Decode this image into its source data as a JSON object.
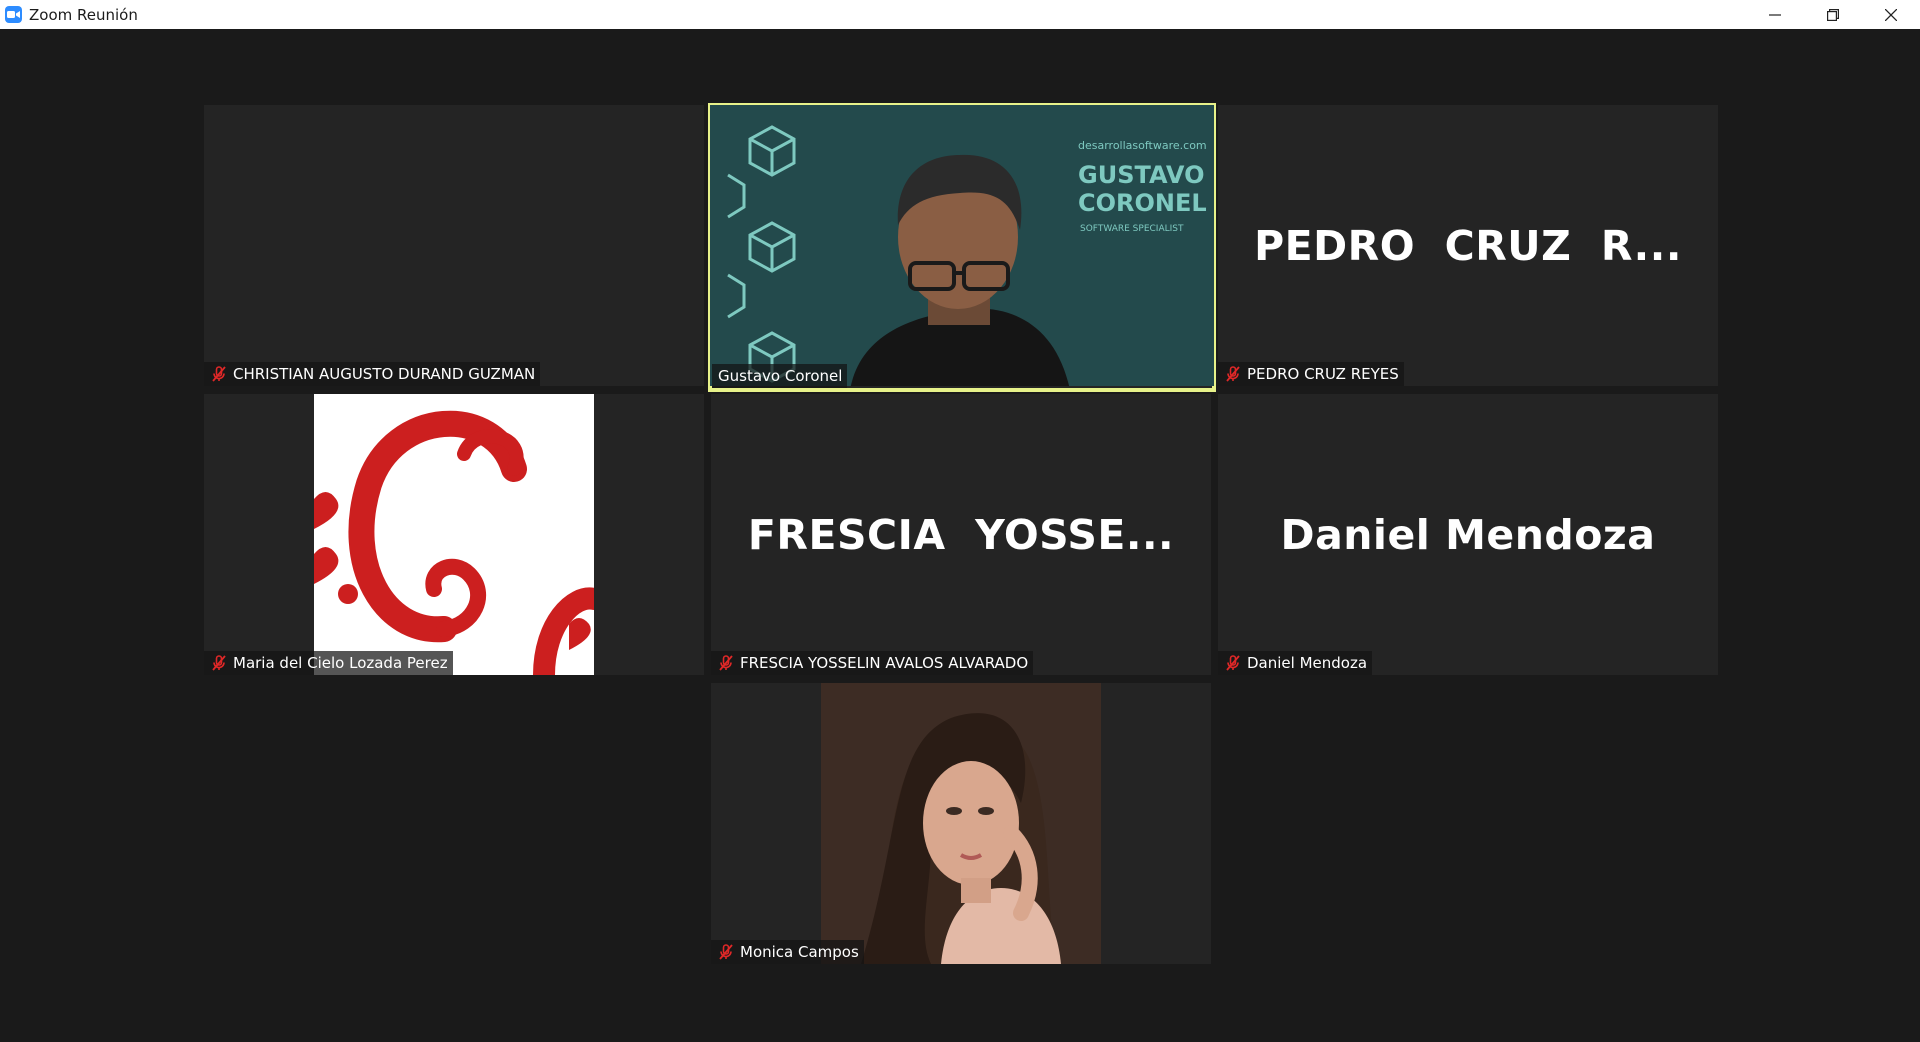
{
  "window": {
    "title": "Zoom Reunión",
    "controls": [
      "minimize-icon",
      "restore-icon",
      "close-icon"
    ]
  },
  "colors": {
    "background": "#1a1a1a",
    "tile": "#242424",
    "active_speaker_border": "#e7f28a",
    "muted_icon": "#e02828",
    "video_background": "#234a4c"
  },
  "participants": [
    {
      "name": "CHRISTIAN AUGUSTO DURAND GUZMAN",
      "muted": true,
      "display": "blank"
    },
    {
      "name": "Gustavo Coronel",
      "muted": false,
      "display": "video",
      "active_speaker": true,
      "background_text": {
        "site": "desarrollasoftware.com",
        "line1": "GUSTAVO",
        "line2": "CORONEL",
        "line3": "SOFTWARE SPECIALIST"
      }
    },
    {
      "name": "PEDRO CRUZ REYES",
      "muted": true,
      "display": "name",
      "big_name": "PEDRO  CRUZ  R..."
    },
    {
      "name": "Maria del Cielo Lozada Perez",
      "muted": true,
      "display": "picture"
    },
    {
      "name": "FRESCIA YOSSELIN AVALOS ALVARADO",
      "muted": true,
      "display": "name",
      "big_name": "FRESCIA  YOSSE..."
    },
    {
      "name": "Daniel Mendoza",
      "muted": true,
      "display": "name",
      "big_name": "Daniel Mendoza"
    },
    {
      "name": "Monica Campos",
      "muted": true,
      "display": "picture"
    }
  ]
}
